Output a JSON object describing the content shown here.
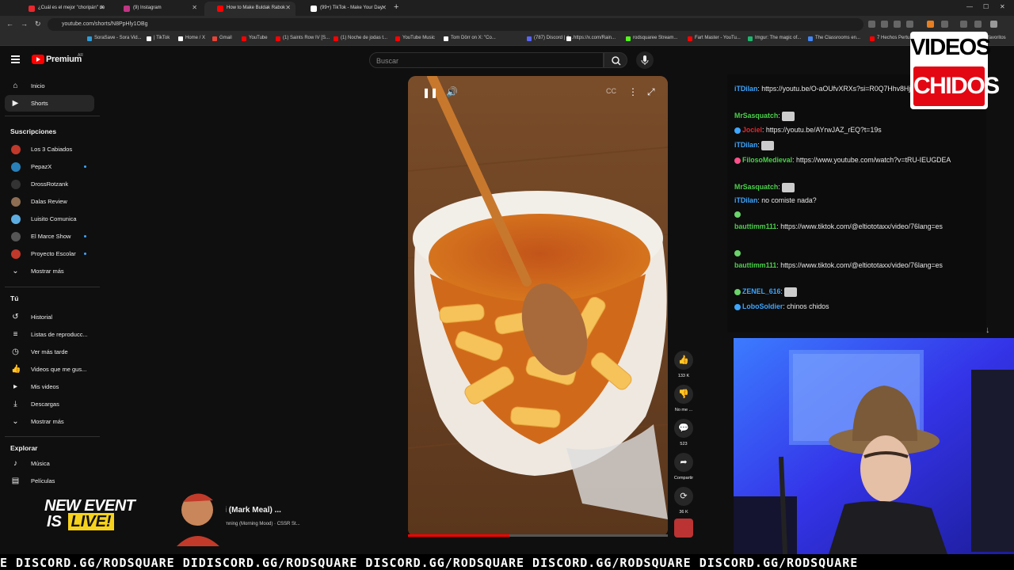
{
  "browser": {
    "tabs": [
      {
        "title": "¿Cuál es el mejor \"choripán\" de",
        "favicon_color": "#e8282e",
        "active": false
      },
      {
        "title": "(9) Instagram",
        "favicon_color": "#c13584",
        "active": false
      },
      {
        "title": "How to Make Buldak Rabok",
        "favicon_color": "#ff0000",
        "active": true
      },
      {
        "title": "(99+) TikTok - Make Your Day",
        "favicon_color": "#ffffff",
        "active": false
      }
    ],
    "url": "youtube.com/shorts/N8PpHly1OBg",
    "bookmarks": [
      {
        "label": "SoraSave - Sora Vid...",
        "color": "#2d9cdb"
      },
      {
        "label": "| TikTok",
        "color": "#ffffff"
      },
      {
        "label": "Home / X",
        "color": "#ffffff"
      },
      {
        "label": "Gmail",
        "color": "#ea4335"
      },
      {
        "label": "YouTube",
        "color": "#ff0000"
      },
      {
        "label": "(1) Saints Row IV [S...",
        "color": "#ff0000"
      },
      {
        "label": "(1) Noche de jodas t...",
        "color": "#ff0000"
      },
      {
        "label": "YouTube Music",
        "color": "#ff0000"
      },
      {
        "label": "Tom Dörr on X: \"Co...",
        "color": "#ffffff"
      },
      {
        "label": "(787) Discord | #...",
        "color": "#5865f2"
      },
      {
        "label": "https://x.com/Rain...",
        "color": "#ffffff"
      },
      {
        "label": "rodsquaree Stream...",
        "color": "#53fc18"
      },
      {
        "label": "Fart Master - YouTu...",
        "color": "#ff0000"
      },
      {
        "label": "Imgur: The magic of...",
        "color": "#1bb76e"
      },
      {
        "label": "The Classrooms en...",
        "color": "#4285f4"
      },
      {
        "label": "7 Hechos Pertu...",
        "color": "#ff0000"
      }
    ],
    "bookmarks_folder": "favoritos"
  },
  "youtube": {
    "brand": "Premium",
    "brand_country": "AR",
    "search_placeholder": "Buscar",
    "sidebar": {
      "main": [
        {
          "label": "Inicio",
          "icon": "home-icon",
          "glyph": "⌂",
          "active": false
        },
        {
          "label": "Shorts",
          "icon": "shorts-icon",
          "glyph": "▶",
          "active": true
        }
      ],
      "subs_heading": "Suscripciones",
      "subscriptions": [
        {
          "label": "Los 3 Cabiados",
          "color": "#c0392b",
          "dot": false
        },
        {
          "label": "PepazX",
          "color": "#2980b9",
          "dot": true
        },
        {
          "label": "DrossRotzank",
          "color": "#333333",
          "dot": false
        },
        {
          "label": "Dalas Review",
          "color": "#8e6e53",
          "dot": false
        },
        {
          "label": "Luisito Comunica",
          "color": "#5dade2",
          "dot": false
        },
        {
          "label": "El Marce Show",
          "color": "#555555",
          "dot": true
        },
        {
          "label": "Proyecto Escolar",
          "color": "#c0392b",
          "dot": true
        }
      ],
      "subs_more": "Mostrar más",
      "you_heading": "Tú",
      "you_items": [
        {
          "label": "Historial",
          "glyph": "↺"
        },
        {
          "label": "Listas de reproducc...",
          "glyph": "≡"
        },
        {
          "label": "Ver más tarde",
          "glyph": "◷"
        },
        {
          "label": "Videos que me gus...",
          "glyph": "👍"
        },
        {
          "label": "Mis videos",
          "glyph": "▸"
        },
        {
          "label": "Descargas",
          "glyph": "⤓"
        }
      ],
      "you_more": "Mostrar más",
      "explore_heading": "Explorar",
      "explore_items": [
        {
          "label": "Música",
          "glyph": "♪"
        },
        {
          "label": "Películas",
          "glyph": "▤"
        }
      ]
    },
    "short": {
      "title": "okki (Mark Meal) ...",
      "sound": "genstemning (Morning Mood) · CSSR St...",
      "progress": 0.39,
      "likes": "133 K",
      "dislike_label": "No me ...",
      "comments": "523",
      "share_label": "Compartir",
      "remix_count": "36 K"
    }
  },
  "stream": {
    "chat": [
      {
        "user": "iTDilan",
        "color": "#3ea6ff",
        "text": "https://youtu.be/O-aOUfvXRXs?si=R0Q7Hhv8HjY0Jooo",
        "emote": false,
        "badge": null
      },
      {
        "user": "MrSasquatch",
        "color": "#4cd04c",
        "text": "",
        "emote": true,
        "badge": null
      },
      {
        "user": "Jociel",
        "color": "#e0282e",
        "text": "https://youtu.be/AYrwJAZ_rEQ?t=19s",
        "emote": false,
        "badge": "#3ea6ff"
      },
      {
        "user": "iTDilan",
        "color": "#3ea6ff",
        "text": "",
        "emote": true,
        "badge": null
      },
      {
        "user": "FilosoMedieval",
        "color": "#4cd04c",
        "text": "https://www.youtube.com/watch?v=tRU-IEUGDEA",
        "emote": false,
        "badge": "#ff4f8b"
      },
      {
        "user": "MrSasquatch",
        "color": "#4cd04c",
        "text": "",
        "emote": true,
        "badge": null
      },
      {
        "user": "iTDilan",
        "color": "#3ea6ff",
        "text": "no comiste nada?",
        "emote": false,
        "badge": null
      },
      {
        "user": "",
        "color": "#6ad36a",
        "text": "",
        "emote": false,
        "badge": "#6ad36a"
      },
      {
        "user": "bauttimm111",
        "color": "#4cd04c",
        "text": "https://www.tiktok.com/@eltiototaxx/video/76lang=es",
        "emote": false,
        "badge": null
      },
      {
        "user": "",
        "color": "#6ad36a",
        "text": "",
        "emote": false,
        "badge": "#6ad36a"
      },
      {
        "user": "bauttimm111",
        "color": "#4cd04c",
        "text": "https://www.tiktok.com/@eltiototaxx/video/76lang=es",
        "emote": false,
        "badge": null
      },
      {
        "user": "ZENEL_616",
        "color": "#3ea6ff",
        "text": "",
        "emote": true,
        "badge": "#6ad36a"
      },
      {
        "user": "LoboSoldier",
        "color": "#3ea6ff",
        "text": "chinos chidos",
        "emote": false,
        "badge": "#3ea6ff"
      }
    ],
    "logo_line1": "VIDEOS",
    "logo_line2": "CHIDOS",
    "event_line1": "NEW EVENT",
    "event_line2_a": "IS",
    "event_line2_b": "LIVE!",
    "ticker": "E DISCORD.GG/RODSQUARE DIDISCORD.GG/RODSQUARE DISCORD.GG/RODSQUARE DISCORD.GG/RODSQUARE DISCORD.GG/RODSQUARE"
  }
}
